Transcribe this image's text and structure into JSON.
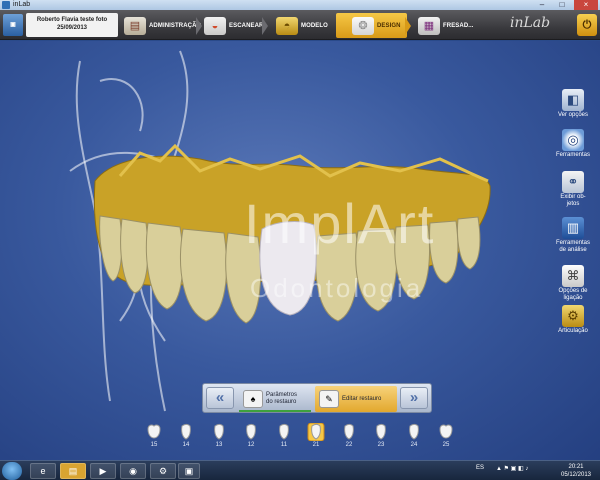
{
  "window": {
    "title": "inLab"
  },
  "header": {
    "patient_name": "Roberto Flavia teste foto",
    "patient_date": "25/09/2013",
    "steps": [
      {
        "label": "ADMINISTRAÇÃO",
        "icon": "folder-icon"
      },
      {
        "label": "ESCANEAR",
        "icon": "scanner-icon"
      },
      {
        "label": "MODELO",
        "icon": "model-icon"
      },
      {
        "label": "DESIGN",
        "icon": "design-icon",
        "active": true
      },
      {
        "label": "FRESAD...",
        "icon": "milling-icon"
      }
    ],
    "brand": "inLab"
  },
  "watermark": {
    "title": "ImplArt",
    "subtitle": "Odontologia"
  },
  "tools": [
    {
      "label": "Ver opções",
      "icon": "cube-view-icon"
    },
    {
      "label": "Ferramentas",
      "icon": "tool-ring-icon"
    },
    {
      "label": "Exibir ob-\njetos",
      "icon": "objects-icon"
    },
    {
      "label": "Ferramentas\nde análise",
      "icon": "analysis-icon"
    },
    {
      "label": "Opções de\nligação",
      "icon": "connection-icon"
    },
    {
      "label": "Articulação",
      "icon": "articulator-icon"
    }
  ],
  "panel": {
    "tab1": "Parâmetros\ndo restauro",
    "tab2": "Editar restauro",
    "prev": "«",
    "next": "»"
  },
  "teeth": [
    "15",
    "14",
    "13",
    "12",
    "11",
    "21",
    "22",
    "23",
    "24",
    "25"
  ],
  "selected_tooth": "21",
  "taskbar": {
    "lang": "ES",
    "time": "20:21",
    "date": "05/12/2013"
  },
  "colors": {
    "accent": "#e5a21e",
    "viewport": "#3a5aa0",
    "crown": "#e8e4e6",
    "gold": "#c9a227"
  }
}
